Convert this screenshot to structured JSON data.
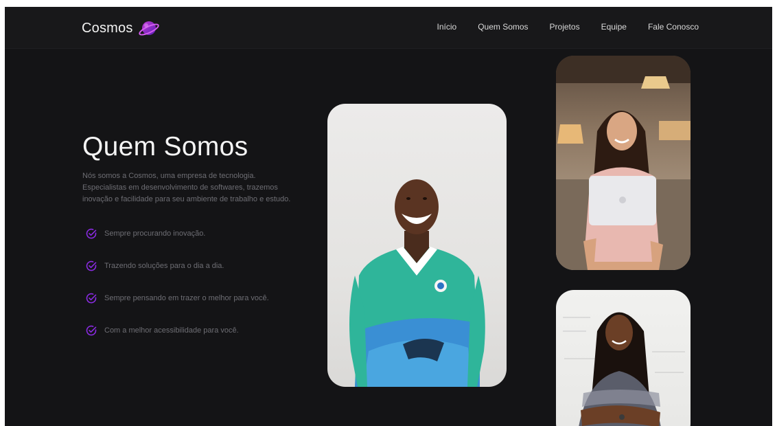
{
  "brand": {
    "name": "Cosmos",
    "logo_icon": "planet-icon"
  },
  "nav": {
    "items": [
      {
        "label": "Início"
      },
      {
        "label": "Quem Somos"
      },
      {
        "label": "Projetos"
      },
      {
        "label": "Equipe"
      },
      {
        "label": "Fale Conosco"
      }
    ]
  },
  "hero": {
    "title": "Quem Somos",
    "description": "Nós somos a Cosmos, uma empresa de tecnologia. Especialistas em desenvolvimento de softwares, trazemos inovação e facilidade para seu ambiente de trabalho e estudo.",
    "features": [
      {
        "icon": "check-circle-icon",
        "text": "Sempre procurando inovação."
      },
      {
        "icon": "check-circle-icon",
        "text": "Trazendo soluções para o dia a dia."
      },
      {
        "icon": "check-circle-icon",
        "text": "Sempre pensando em trazer o melhor para você."
      },
      {
        "icon": "check-circle-icon",
        "text": "Com a melhor acessibilidade para você."
      }
    ]
  },
  "colors": {
    "background": "#141416",
    "accent": "#8a2be2",
    "text_primary": "#f4f4f4",
    "text_muted": "#6e6e74"
  }
}
